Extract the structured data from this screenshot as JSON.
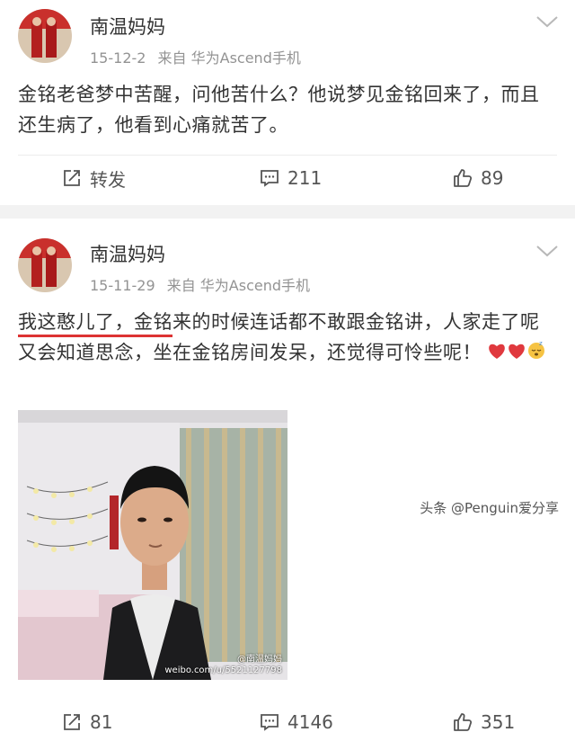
{
  "posts": [
    {
      "username": "南温妈妈",
      "date": "15-12-2",
      "source": "来自 华为Ascend手机",
      "text": "金铭老爸梦中苦醒，问他苦什么？他说梦见金铭回来了，而且还生病了，他看到心痛就苦了。",
      "repost_label": "转发",
      "comments": "211",
      "likes": "89"
    },
    {
      "username": "南温妈妈",
      "date": "15-11-29",
      "source": "来自 华为Ascend手机",
      "text_underlined": "我这憨儿了，金铭",
      "text_rest": "来的时候连话都不敢跟金铭讲，人家走了呢又会知道思念，坐在金铭房间发呆，还觉得可怜些呢！",
      "photo_watermark_user": "@南温妈妈",
      "photo_watermark_url": "weibo.com/u/5521127798",
      "reposts": "81",
      "comments": "4146",
      "likes": "351"
    }
  ],
  "credit": "头条 @Penguin爱分享",
  "colors": {
    "accent_underline": "#dd3333",
    "meta_gray": "#939393",
    "heart_red": "#e0393e"
  }
}
